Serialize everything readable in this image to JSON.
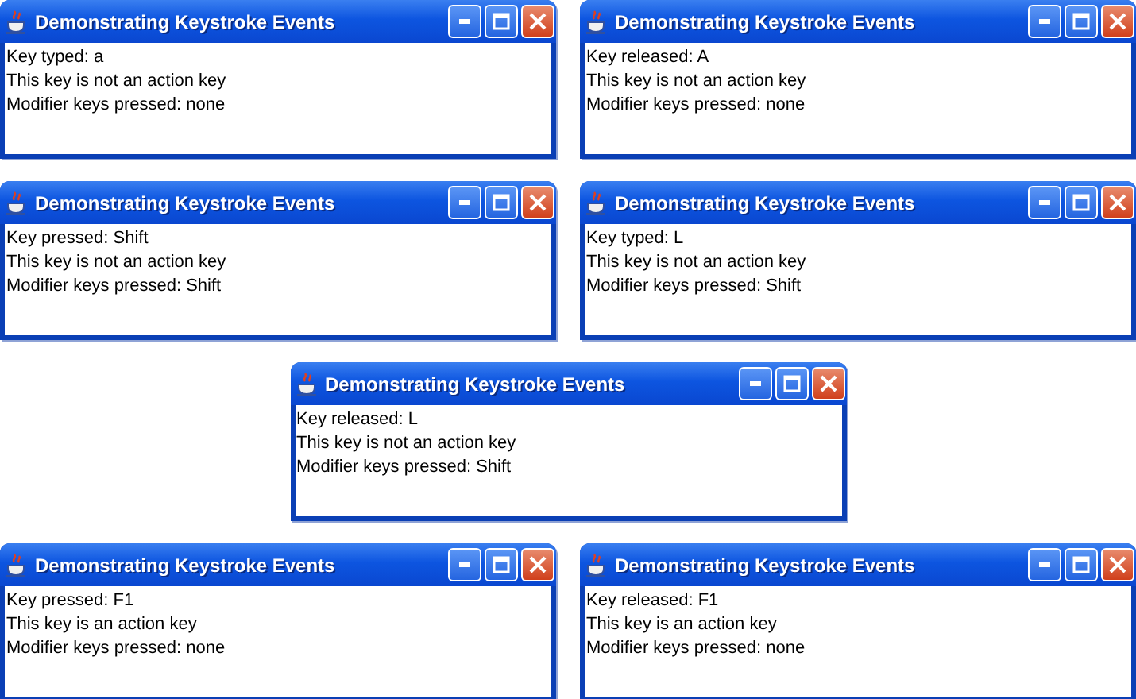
{
  "rows": [
    {
      "windows": [
        {
          "title": "Demonstrating Keystroke Events",
          "lines": [
            "Key typed: a",
            "This key is not an action key",
            "Modifier keys pressed: none"
          ]
        },
        {
          "title": "Demonstrating Keystroke Events",
          "lines": [
            "Key released: A",
            "This key is not an action key",
            "Modifier keys pressed: none"
          ]
        }
      ]
    },
    {
      "windows": [
        {
          "title": "Demonstrating Keystroke Events",
          "lines": [
            "Key pressed: Shift",
            "This key is not an action key",
            "Modifier keys pressed: Shift"
          ]
        },
        {
          "title": "Demonstrating Keystroke Events",
          "lines": [
            "Key typed: L",
            "This key is not an action key",
            "Modifier keys pressed: Shift"
          ]
        }
      ]
    },
    {
      "windows": [
        {
          "title": "Demonstrating Keystroke Events",
          "lines": [
            "Key released: L",
            "This key is not an action key",
            "Modifier keys pressed: Shift"
          ]
        }
      ]
    },
    {
      "windows": [
        {
          "title": "Demonstrating Keystroke Events",
          "lines": [
            "Key pressed: F1",
            "This key is an action key",
            "Modifier keys pressed: none"
          ]
        },
        {
          "title": "Demonstrating Keystroke Events",
          "lines": [
            "Key released: F1",
            "This key is an action key",
            "Modifier keys pressed: none"
          ]
        }
      ]
    }
  ]
}
